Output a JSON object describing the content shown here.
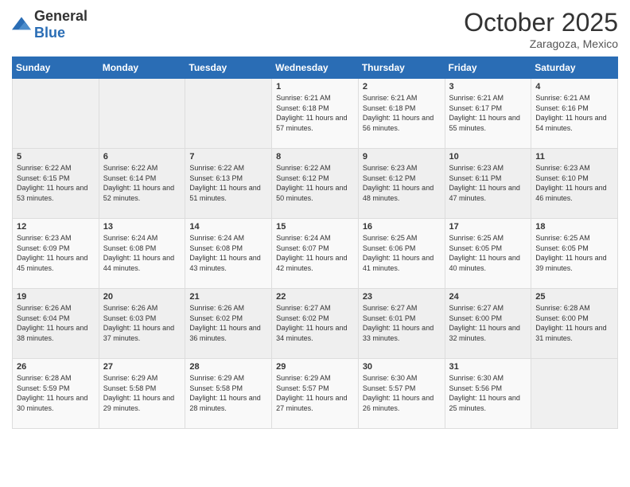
{
  "header": {
    "logo_general": "General",
    "logo_blue": "Blue",
    "month_title": "October 2025",
    "location": "Zaragoza, Mexico"
  },
  "weekdays": [
    "Sunday",
    "Monday",
    "Tuesday",
    "Wednesday",
    "Thursday",
    "Friday",
    "Saturday"
  ],
  "weeks": [
    [
      {
        "day": "",
        "text": ""
      },
      {
        "day": "",
        "text": ""
      },
      {
        "day": "",
        "text": ""
      },
      {
        "day": "1",
        "text": "Sunrise: 6:21 AM\nSunset: 6:18 PM\nDaylight: 11 hours and 57 minutes."
      },
      {
        "day": "2",
        "text": "Sunrise: 6:21 AM\nSunset: 6:18 PM\nDaylight: 11 hours and 56 minutes."
      },
      {
        "day": "3",
        "text": "Sunrise: 6:21 AM\nSunset: 6:17 PM\nDaylight: 11 hours and 55 minutes."
      },
      {
        "day": "4",
        "text": "Sunrise: 6:21 AM\nSunset: 6:16 PM\nDaylight: 11 hours and 54 minutes."
      }
    ],
    [
      {
        "day": "5",
        "text": "Sunrise: 6:22 AM\nSunset: 6:15 PM\nDaylight: 11 hours and 53 minutes."
      },
      {
        "day": "6",
        "text": "Sunrise: 6:22 AM\nSunset: 6:14 PM\nDaylight: 11 hours and 52 minutes."
      },
      {
        "day": "7",
        "text": "Sunrise: 6:22 AM\nSunset: 6:13 PM\nDaylight: 11 hours and 51 minutes."
      },
      {
        "day": "8",
        "text": "Sunrise: 6:22 AM\nSunset: 6:12 PM\nDaylight: 11 hours and 50 minutes."
      },
      {
        "day": "9",
        "text": "Sunrise: 6:23 AM\nSunset: 6:12 PM\nDaylight: 11 hours and 48 minutes."
      },
      {
        "day": "10",
        "text": "Sunrise: 6:23 AM\nSunset: 6:11 PM\nDaylight: 11 hours and 47 minutes."
      },
      {
        "day": "11",
        "text": "Sunrise: 6:23 AM\nSunset: 6:10 PM\nDaylight: 11 hours and 46 minutes."
      }
    ],
    [
      {
        "day": "12",
        "text": "Sunrise: 6:23 AM\nSunset: 6:09 PM\nDaylight: 11 hours and 45 minutes."
      },
      {
        "day": "13",
        "text": "Sunrise: 6:24 AM\nSunset: 6:08 PM\nDaylight: 11 hours and 44 minutes."
      },
      {
        "day": "14",
        "text": "Sunrise: 6:24 AM\nSunset: 6:08 PM\nDaylight: 11 hours and 43 minutes."
      },
      {
        "day": "15",
        "text": "Sunrise: 6:24 AM\nSunset: 6:07 PM\nDaylight: 11 hours and 42 minutes."
      },
      {
        "day": "16",
        "text": "Sunrise: 6:25 AM\nSunset: 6:06 PM\nDaylight: 11 hours and 41 minutes."
      },
      {
        "day": "17",
        "text": "Sunrise: 6:25 AM\nSunset: 6:05 PM\nDaylight: 11 hours and 40 minutes."
      },
      {
        "day": "18",
        "text": "Sunrise: 6:25 AM\nSunset: 6:05 PM\nDaylight: 11 hours and 39 minutes."
      }
    ],
    [
      {
        "day": "19",
        "text": "Sunrise: 6:26 AM\nSunset: 6:04 PM\nDaylight: 11 hours and 38 minutes."
      },
      {
        "day": "20",
        "text": "Sunrise: 6:26 AM\nSunset: 6:03 PM\nDaylight: 11 hours and 37 minutes."
      },
      {
        "day": "21",
        "text": "Sunrise: 6:26 AM\nSunset: 6:02 PM\nDaylight: 11 hours and 36 minutes."
      },
      {
        "day": "22",
        "text": "Sunrise: 6:27 AM\nSunset: 6:02 PM\nDaylight: 11 hours and 34 minutes."
      },
      {
        "day": "23",
        "text": "Sunrise: 6:27 AM\nSunset: 6:01 PM\nDaylight: 11 hours and 33 minutes."
      },
      {
        "day": "24",
        "text": "Sunrise: 6:27 AM\nSunset: 6:00 PM\nDaylight: 11 hours and 32 minutes."
      },
      {
        "day": "25",
        "text": "Sunrise: 6:28 AM\nSunset: 6:00 PM\nDaylight: 11 hours and 31 minutes."
      }
    ],
    [
      {
        "day": "26",
        "text": "Sunrise: 6:28 AM\nSunset: 5:59 PM\nDaylight: 11 hours and 30 minutes."
      },
      {
        "day": "27",
        "text": "Sunrise: 6:29 AM\nSunset: 5:58 PM\nDaylight: 11 hours and 29 minutes."
      },
      {
        "day": "28",
        "text": "Sunrise: 6:29 AM\nSunset: 5:58 PM\nDaylight: 11 hours and 28 minutes."
      },
      {
        "day": "29",
        "text": "Sunrise: 6:29 AM\nSunset: 5:57 PM\nDaylight: 11 hours and 27 minutes."
      },
      {
        "day": "30",
        "text": "Sunrise: 6:30 AM\nSunset: 5:57 PM\nDaylight: 11 hours and 26 minutes."
      },
      {
        "day": "31",
        "text": "Sunrise: 6:30 AM\nSunset: 5:56 PM\nDaylight: 11 hours and 25 minutes."
      },
      {
        "day": "",
        "text": ""
      }
    ]
  ]
}
